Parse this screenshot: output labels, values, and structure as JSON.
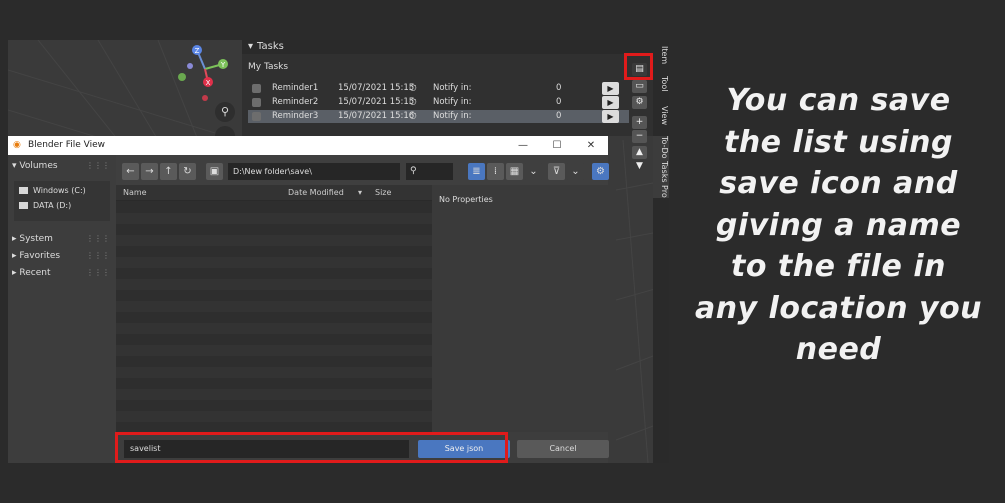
{
  "tasks_panel": {
    "header": "Tasks",
    "list_label": "My Tasks",
    "rows": [
      {
        "name": "Reminder1",
        "date": "15/07/2021 15:15",
        "notify_label": "Notify in:",
        "value": "0"
      },
      {
        "name": "Reminder2",
        "date": "15/07/2021 15:15",
        "notify_label": "Notify in:",
        "value": "0"
      },
      {
        "name": "Reminder3",
        "date": "15/07/2021 15:16",
        "notify_label": "Notify in:",
        "value": "0"
      }
    ]
  },
  "side_tabs": [
    "Item",
    "Tool",
    "View",
    "To-Do Tasks Pro"
  ],
  "gizmo": {
    "z_label": "Z",
    "y_label": "Y",
    "x_label": "X"
  },
  "dialog": {
    "title": "Blender File View",
    "sidebar": {
      "volumes_label": "Volumes",
      "drives": [
        "Windows (C:)",
        "DATA (D:)"
      ],
      "sections": [
        "System",
        "Favorites",
        "Recent"
      ]
    },
    "path": "D:\\New folder\\save\\",
    "columns": [
      "Name",
      "Date Modified",
      "Size"
    ],
    "properties_text": "No Properties",
    "filename": "savelist",
    "save_label": "Save json",
    "cancel_label": "Cancel"
  },
  "caption_lines": [
    "You can save",
    "the list using",
    "save icon and",
    "giving a name",
    "to the file in",
    "any location you",
    "need"
  ],
  "colors": {
    "highlight": "#e01b1b",
    "accent_button": "#4a77c0",
    "caption_text": "#f2f2f2"
  }
}
